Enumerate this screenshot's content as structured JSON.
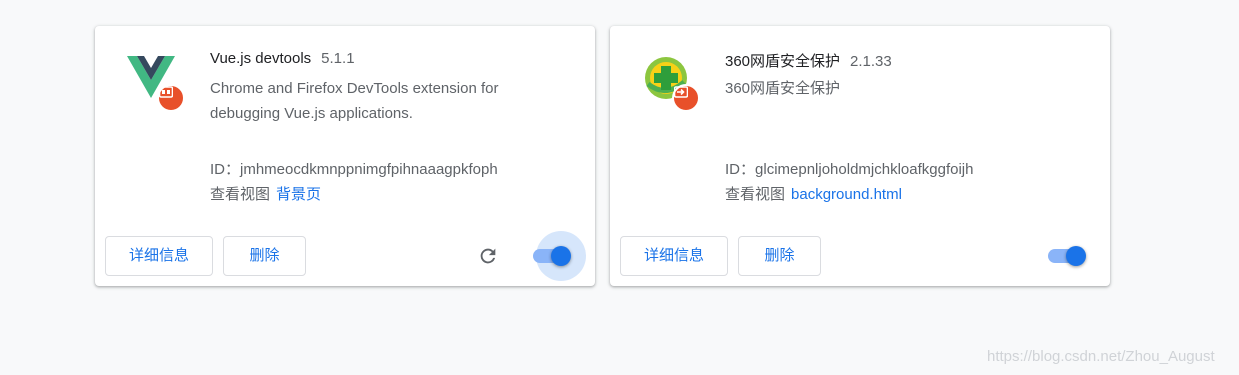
{
  "extensions": [
    {
      "name": "Vue.js devtools",
      "version": "5.1.1",
      "description": "Chrome and Firefox DevTools extension for debugging Vue.js applications.",
      "id_label": "ID：",
      "id": "jmhmeocdkmnppnimgfpihnaaagpkfoph",
      "views_label": "查看视图",
      "view_link": "背景页",
      "details_label": "详细信息",
      "remove_label": "删除",
      "enabled": true,
      "icon": "vue-logo-icon"
    },
    {
      "name": "360网盾安全保护",
      "version": "2.1.33",
      "description": "360网盾安全保护",
      "id_label": "ID：",
      "id": "glcimepnljoholdmjchkloafkggfoijh",
      "views_label": "查看视图",
      "view_link": "background.html",
      "details_label": "详细信息",
      "remove_label": "删除",
      "enabled": true,
      "icon": "360-shield-icon"
    }
  ],
  "watermark": "https://blog.csdn.net/Zhou_August",
  "colors": {
    "accent": "#1a73e8",
    "badge": "#e8502a",
    "vue_green": "#41b883",
    "vue_dark": "#35495e"
  }
}
